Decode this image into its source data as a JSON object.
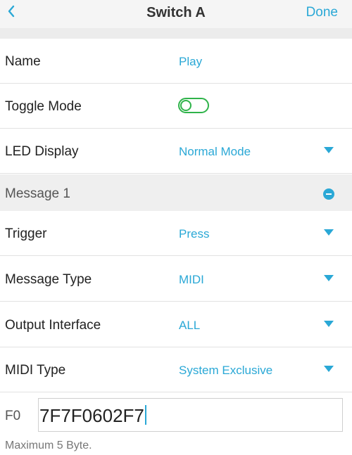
{
  "header": {
    "back_icon": "chevron-left-icon",
    "title": "Switch A",
    "done_label": "Done"
  },
  "colors": {
    "accent": "#2aa8d6",
    "toggle_green": "#2fb34a",
    "header_bg": "#f5f5f5",
    "section_bg": "#efefef"
  },
  "settings": {
    "name": {
      "label": "Name",
      "value": "Play"
    },
    "toggle_mode": {
      "label": "Toggle Mode",
      "on": false
    },
    "led_display": {
      "label": "LED Display",
      "value": "Normal Mode",
      "icon": "caret-down-icon"
    }
  },
  "message": {
    "title": "Message 1",
    "remove_icon": "minus-circle-icon",
    "trigger": {
      "label": "Trigger",
      "value": "Press"
    },
    "message_type": {
      "label": "Message Type",
      "value": "MIDI"
    },
    "output_interface": {
      "label": "Output Interface",
      "value": "ALL"
    },
    "midi_type": {
      "label": "MIDI Type",
      "value": "System Exclusive"
    },
    "sysex": {
      "prefix": "F0",
      "value": "7F7F0602F7",
      "hint": "Maximum 5 Byte."
    }
  }
}
